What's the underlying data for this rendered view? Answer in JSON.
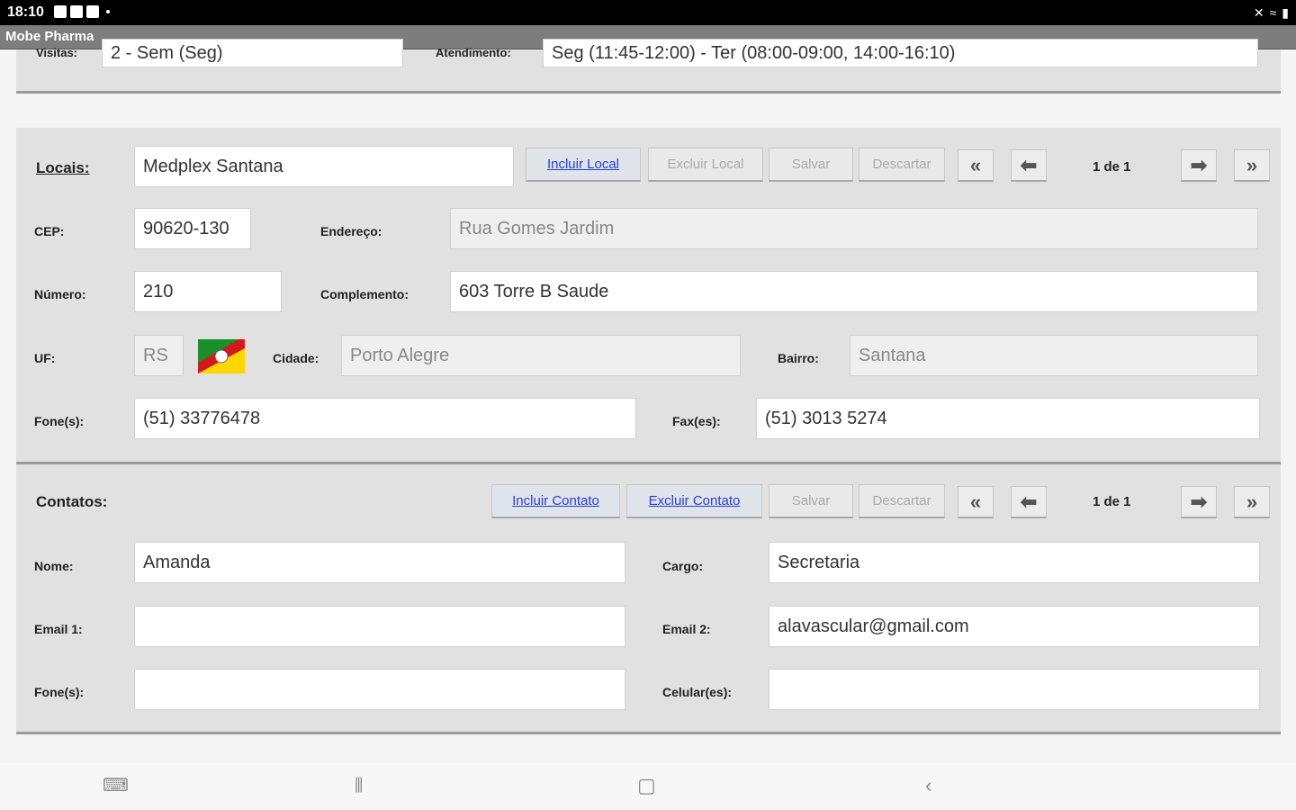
{
  "status": {
    "time": "18:10"
  },
  "app": {
    "title": "Mobe Pharma"
  },
  "top_partial": {
    "visits_label": "Visitas:",
    "visits_value": "2 - Sem (Seg)",
    "attend_label": "Atendimento:",
    "attend_value": "Seg (11:45-12:00) - Ter (08:00-09:00, 14:00-16:10)"
  },
  "locais": {
    "label": "Locais:",
    "value": "Medplex Santana",
    "buttons": {
      "incluir": "Incluir Local",
      "excluir": "Excluir Local",
      "salvar": "Salvar",
      "descartar": "Descartar"
    },
    "pager": "1 de 1",
    "cep_label": "CEP:",
    "cep": "90620-130",
    "endereco_label": "Endereço:",
    "endereco": "Rua Gomes Jardim",
    "numero_label": "Número:",
    "numero": "210",
    "complemento_label": "Complemento:",
    "complemento": "603 Torre B Saude",
    "uf_label": "UF:",
    "uf": "RS",
    "cidade_label": "Cidade:",
    "cidade": "Porto Alegre",
    "bairro_label": "Bairro:",
    "bairro": "Santana",
    "fone_label": "Fone(s):",
    "fone": "(51) 33776478",
    "fax_label": "Fax(es):",
    "fax": "(51) 3013 5274"
  },
  "contatos": {
    "label": "Contatos:",
    "buttons": {
      "incluir": "Incluir Contato",
      "excluir": "Excluir Contato",
      "salvar": "Salvar",
      "descartar": "Descartar"
    },
    "pager": "1 de 1",
    "nome_label": "Nome:",
    "nome": "Amanda",
    "cargo_label": "Cargo:",
    "cargo": "Secretaria",
    "email1_label": "Email 1:",
    "email1": "",
    "email2_label": "Email 2:",
    "email2": "alavascular@gmail.com",
    "fone_label": "Fone(s):",
    "fone": "",
    "celular_label": "Celular(es):",
    "celular": ""
  },
  "colors": {
    "link": "#2b3fd6",
    "panel": "#e1e1e1"
  }
}
